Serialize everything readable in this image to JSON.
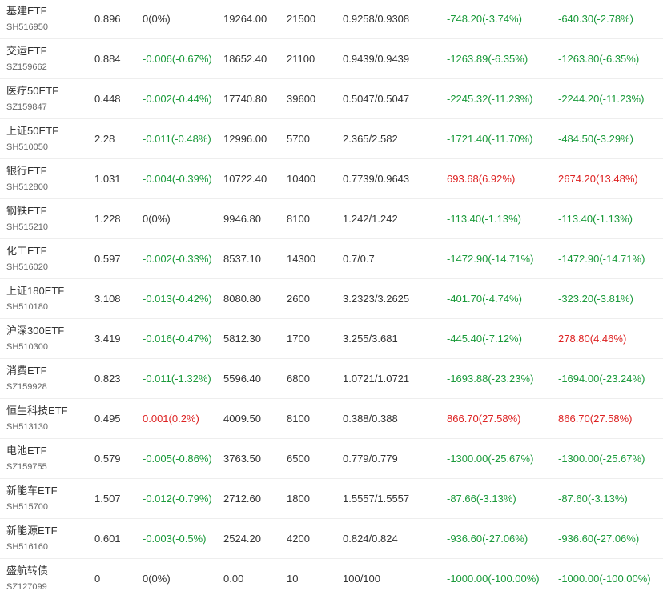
{
  "holdings": [
    {
      "name": "基建ETF",
      "code": "SH516950",
      "price": "0.896",
      "change": "0(0%)",
      "change_dir": "neutral",
      "value": "19264.00",
      "qty": "21500",
      "cost": "0.9258/0.9308",
      "pl1": "-748.20(-3.74%)",
      "pl1_dir": "green",
      "pl2": "-640.30(-2.78%)",
      "pl2_dir": "green"
    },
    {
      "name": "交运ETF",
      "code": "SZ159662",
      "price": "0.884",
      "change": "-0.006(-0.67%)",
      "change_dir": "green",
      "value": "18652.40",
      "qty": "21100",
      "cost": "0.9439/0.9439",
      "pl1": "-1263.89(-6.35%)",
      "pl1_dir": "green",
      "pl2": "-1263.80(-6.35%)",
      "pl2_dir": "green"
    },
    {
      "name": "医疗50ETF",
      "code": "SZ159847",
      "price": "0.448",
      "change": "-0.002(-0.44%)",
      "change_dir": "green",
      "value": "17740.80",
      "qty": "39600",
      "cost": "0.5047/0.5047",
      "pl1": "-2245.32(-11.23%)",
      "pl1_dir": "green",
      "pl2": "-2244.20(-11.23%)",
      "pl2_dir": "green"
    },
    {
      "name": "上证50ETF",
      "code": "SH510050",
      "price": "2.28",
      "change": "-0.011(-0.48%)",
      "change_dir": "green",
      "value": "12996.00",
      "qty": "5700",
      "cost": "2.365/2.582",
      "pl1": "-1721.40(-11.70%)",
      "pl1_dir": "green",
      "pl2": "-484.50(-3.29%)",
      "pl2_dir": "green"
    },
    {
      "name": "银行ETF",
      "code": "SH512800",
      "price": "1.031",
      "change": "-0.004(-0.39%)",
      "change_dir": "green",
      "value": "10722.40",
      "qty": "10400",
      "cost": "0.7739/0.9643",
      "pl1": "693.68(6.92%)",
      "pl1_dir": "red",
      "pl2": "2674.20(13.48%)",
      "pl2_dir": "red"
    },
    {
      "name": "钢铁ETF",
      "code": "SH515210",
      "price": "1.228",
      "change": "0(0%)",
      "change_dir": "neutral",
      "value": "9946.80",
      "qty": "8100",
      "cost": "1.242/1.242",
      "pl1": "-113.40(-1.13%)",
      "pl1_dir": "green",
      "pl2": "-113.40(-1.13%)",
      "pl2_dir": "green"
    },
    {
      "name": "化工ETF",
      "code": "SH516020",
      "price": "0.597",
      "change": "-0.002(-0.33%)",
      "change_dir": "green",
      "value": "8537.10",
      "qty": "14300",
      "cost": "0.7/0.7",
      "pl1": "-1472.90(-14.71%)",
      "pl1_dir": "green",
      "pl2": "-1472.90(-14.71%)",
      "pl2_dir": "green"
    },
    {
      "name": "上证180ETF",
      "code": "SH510180",
      "price": "3.108",
      "change": "-0.013(-0.42%)",
      "change_dir": "green",
      "value": "8080.80",
      "qty": "2600",
      "cost": "3.2323/3.2625",
      "pl1": "-401.70(-4.74%)",
      "pl1_dir": "green",
      "pl2": "-323.20(-3.81%)",
      "pl2_dir": "green"
    },
    {
      "name": "沪深300ETF",
      "code": "SH510300",
      "price": "3.419",
      "change": "-0.016(-0.47%)",
      "change_dir": "green",
      "value": "5812.30",
      "qty": "1700",
      "cost": "3.255/3.681",
      "pl1": "-445.40(-7.12%)",
      "pl1_dir": "green",
      "pl2": "278.80(4.46%)",
      "pl2_dir": "red"
    },
    {
      "name": "消费ETF",
      "code": "SZ159928",
      "price": "0.823",
      "change": "-0.011(-1.32%)",
      "change_dir": "green",
      "value": "5596.40",
      "qty": "6800",
      "cost": "1.0721/1.0721",
      "pl1": "-1693.88(-23.23%)",
      "pl1_dir": "green",
      "pl2": "-1694.00(-23.24%)",
      "pl2_dir": "green"
    },
    {
      "name": "恒生科技ETF",
      "code": "SH513130",
      "price": "0.495",
      "change": "0.001(0.2%)",
      "change_dir": "red",
      "value": "4009.50",
      "qty": "8100",
      "cost": "0.388/0.388",
      "pl1": "866.70(27.58%)",
      "pl1_dir": "red",
      "pl2": "866.70(27.58%)",
      "pl2_dir": "red"
    },
    {
      "name": "电池ETF",
      "code": "SZ159755",
      "price": "0.579",
      "change": "-0.005(-0.86%)",
      "change_dir": "green",
      "value": "3763.50",
      "qty": "6500",
      "cost": "0.779/0.779",
      "pl1": "-1300.00(-25.67%)",
      "pl1_dir": "green",
      "pl2": "-1300.00(-25.67%)",
      "pl2_dir": "green"
    },
    {
      "name": "新能车ETF",
      "code": "SH515700",
      "price": "1.507",
      "change": "-0.012(-0.79%)",
      "change_dir": "green",
      "value": "2712.60",
      "qty": "1800",
      "cost": "1.5557/1.5557",
      "pl1": "-87.66(-3.13%)",
      "pl1_dir": "green",
      "pl2": "-87.60(-3.13%)",
      "pl2_dir": "green"
    },
    {
      "name": "新能源ETF",
      "code": "SH516160",
      "price": "0.601",
      "change": "-0.003(-0.5%)",
      "change_dir": "green",
      "value": "2524.20",
      "qty": "4200",
      "cost": "0.824/0.824",
      "pl1": "-936.60(-27.06%)",
      "pl1_dir": "green",
      "pl2": "-936.60(-27.06%)",
      "pl2_dir": "green"
    },
    {
      "name": "盛航转债",
      "code": "SZ127099",
      "price": "0",
      "change": "0(0%)",
      "change_dir": "neutral",
      "value": "0.00",
      "qty": "10",
      "cost": "100/100",
      "pl1": "-1000.00(-100.00%)",
      "pl1_dir": "green",
      "pl2": "-1000.00(-100.00%)",
      "pl2_dir": "green"
    }
  ]
}
